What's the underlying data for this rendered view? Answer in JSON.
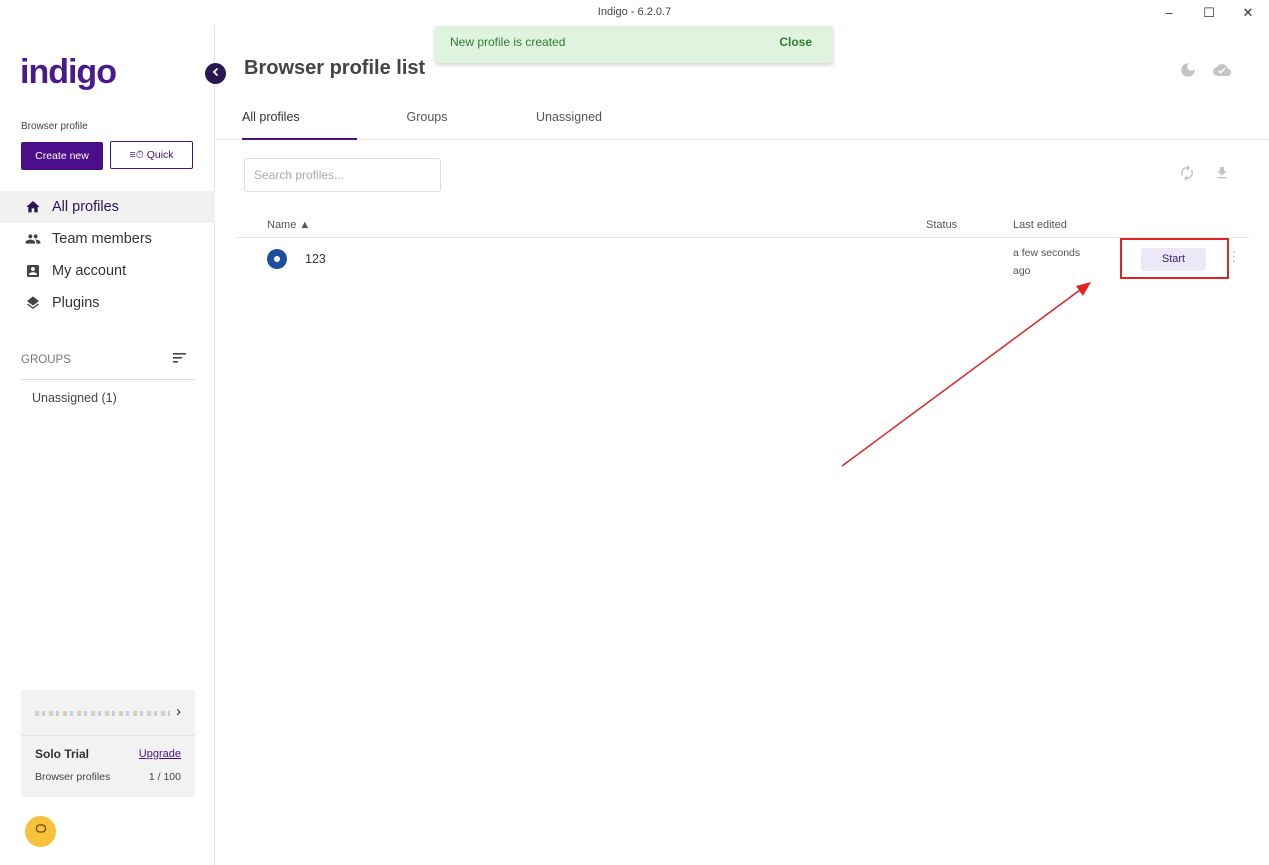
{
  "window": {
    "title": "Indigo - 6.2.0.7",
    "minimize_glyph": "–",
    "maximize_glyph": "☐",
    "close_glyph": "✕"
  },
  "sidebar": {
    "logo": "indigo",
    "section_label": "Browser profile",
    "create_button": "Create new",
    "quick_button": "Quick",
    "nav": [
      {
        "label": "All profiles",
        "icon": "home-icon",
        "active": true
      },
      {
        "label": "Team members",
        "icon": "people-icon",
        "active": false
      },
      {
        "label": "My account",
        "icon": "account-box-icon",
        "active": false
      },
      {
        "label": "Plugins",
        "icon": "layers-icon",
        "active": false
      }
    ],
    "groups_label": "GROUPS",
    "groups": [
      {
        "label": "Unassigned  (1)"
      }
    ],
    "plan": {
      "name": "Solo Trial",
      "upgrade": "Upgrade",
      "profiles_label": "Browser profiles",
      "profiles_count": "1 / 100"
    }
  },
  "main": {
    "title": "Browser profile list",
    "tabs": [
      {
        "label": "All profiles",
        "active": true
      },
      {
        "label": "Groups",
        "active": false
      },
      {
        "label": "Unassigned",
        "active": false
      }
    ],
    "search": {
      "placeholder": "Search profiles..."
    },
    "table": {
      "columns": {
        "name": "Name ▲",
        "status": "Status",
        "last_edited": "Last edited"
      },
      "rows": [
        {
          "name": "123",
          "status": "",
          "last_edited": "a few seconds ago",
          "action": "Start"
        }
      ]
    }
  },
  "toast": {
    "message": "New profile is created",
    "close": "Close"
  },
  "colors": {
    "brand": "#4b0f8c",
    "toast_bg": "#dff3df",
    "toast_text": "#2e7d32",
    "annotation_red": "#e02424",
    "help_button": "#f7c13b"
  }
}
